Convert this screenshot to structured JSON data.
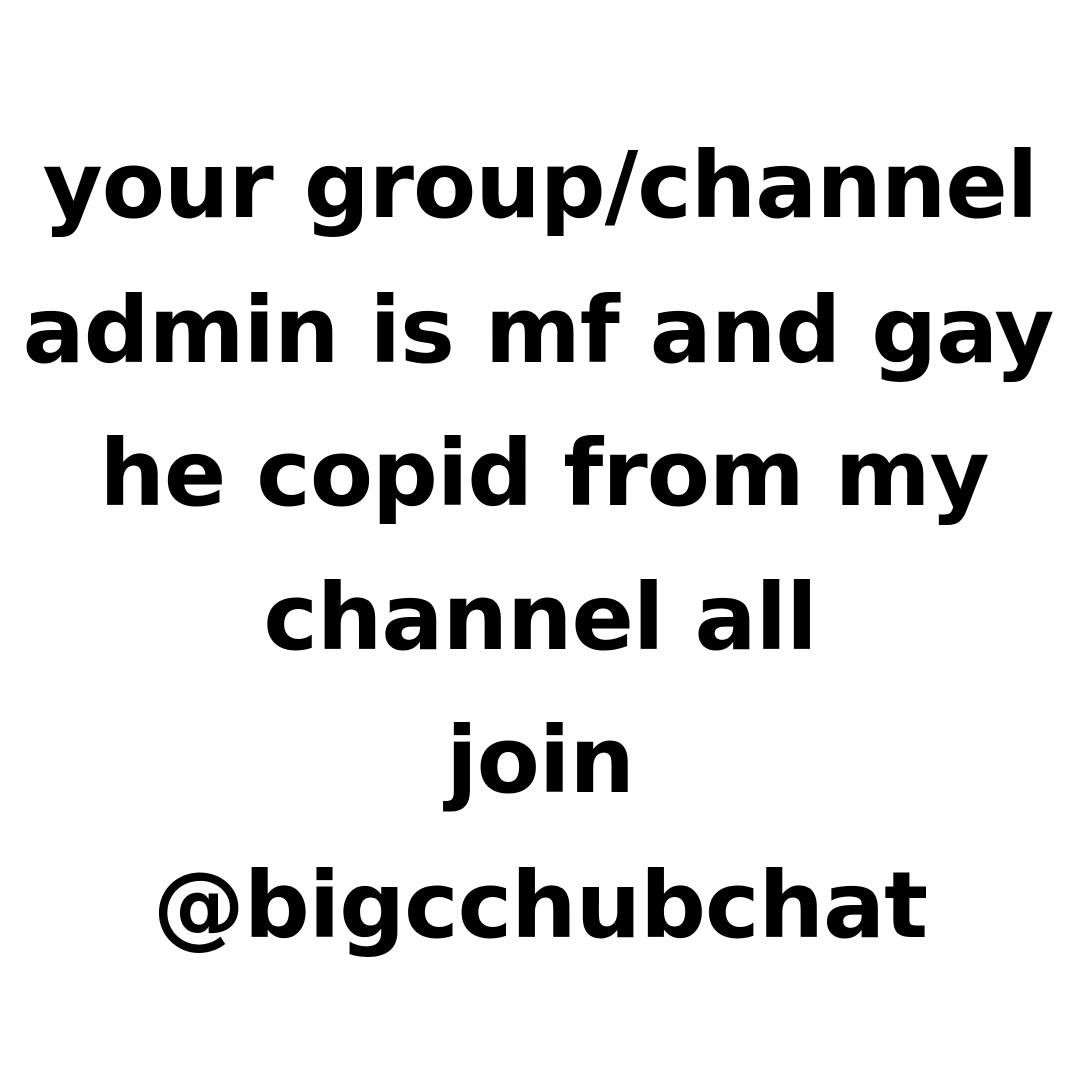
{
  "lines": [
    "your group/channel",
    "admin is mf and gay",
    "he copid from my",
    "channel all",
    "join",
    "@bigcchubchat"
  ],
  "colors": {
    "background": "#ffffff",
    "text": "#000000"
  }
}
